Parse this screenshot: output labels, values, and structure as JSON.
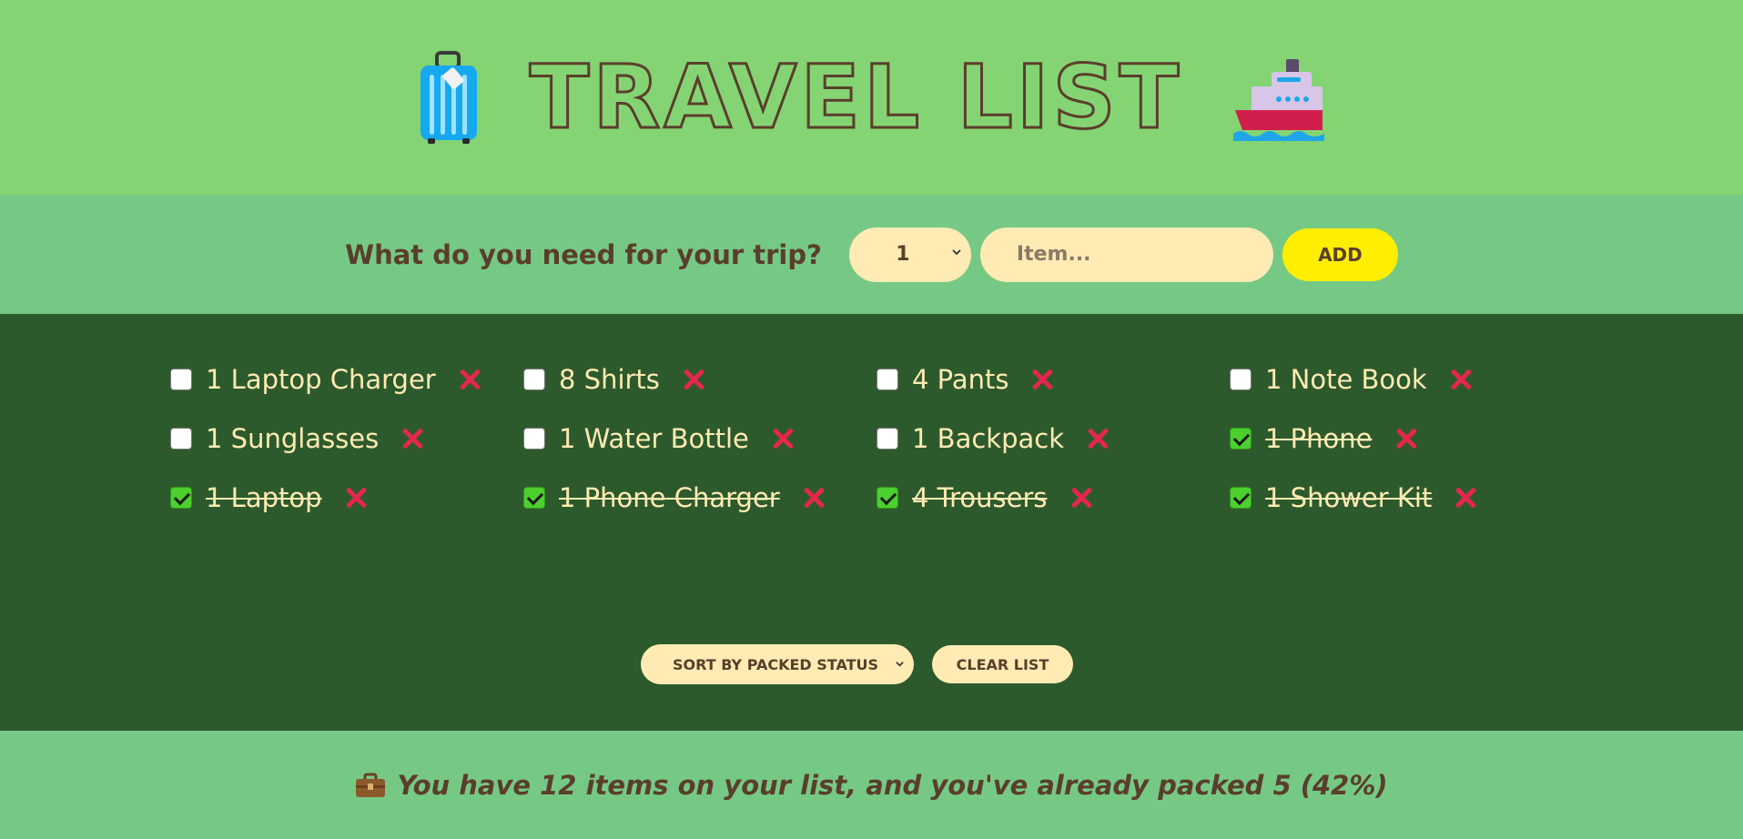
{
  "header": {
    "title": "TRAVEL LIST",
    "left_icon": "luggage-icon",
    "right_icon": "ship-icon"
  },
  "form": {
    "question": "What do you need for your trip?",
    "quantity": "1",
    "item_placeholder": "Item...",
    "add_label": "ADD"
  },
  "items": [
    {
      "label": "1 Laptop Charger",
      "packed": false
    },
    {
      "label": "8 Shirts",
      "packed": false
    },
    {
      "label": "4 Pants",
      "packed": false
    },
    {
      "label": "1 Note Book",
      "packed": false
    },
    {
      "label": "1 Sunglasses",
      "packed": false
    },
    {
      "label": "1 Water Bottle",
      "packed": false
    },
    {
      "label": "1 Backpack",
      "packed": false
    },
    {
      "label": "1 Phone",
      "packed": true
    },
    {
      "label": "1 Laptop",
      "packed": true
    },
    {
      "label": "1 Phone Charger",
      "packed": true
    },
    {
      "label": "4 Trousers",
      "packed": true
    },
    {
      "label": "1 Shower Kit",
      "packed": true
    }
  ],
  "actions": {
    "sort_label": "SORT BY PACKED STATUS",
    "clear_label": "CLEAR LIST"
  },
  "stats": {
    "icon": "briefcase-icon",
    "text": "You have 12 items on your list, and you've already packed 5 (42%)"
  },
  "colors": {
    "header_bg": "#84d474",
    "form_bg": "#76c985",
    "list_bg": "#2d5a2c",
    "text_brown": "#5a3e2b",
    "cream": "#ffebb3",
    "add_yellow": "#ffee00",
    "delete_red": "#e5264e",
    "check_green": "#4cd02f"
  }
}
